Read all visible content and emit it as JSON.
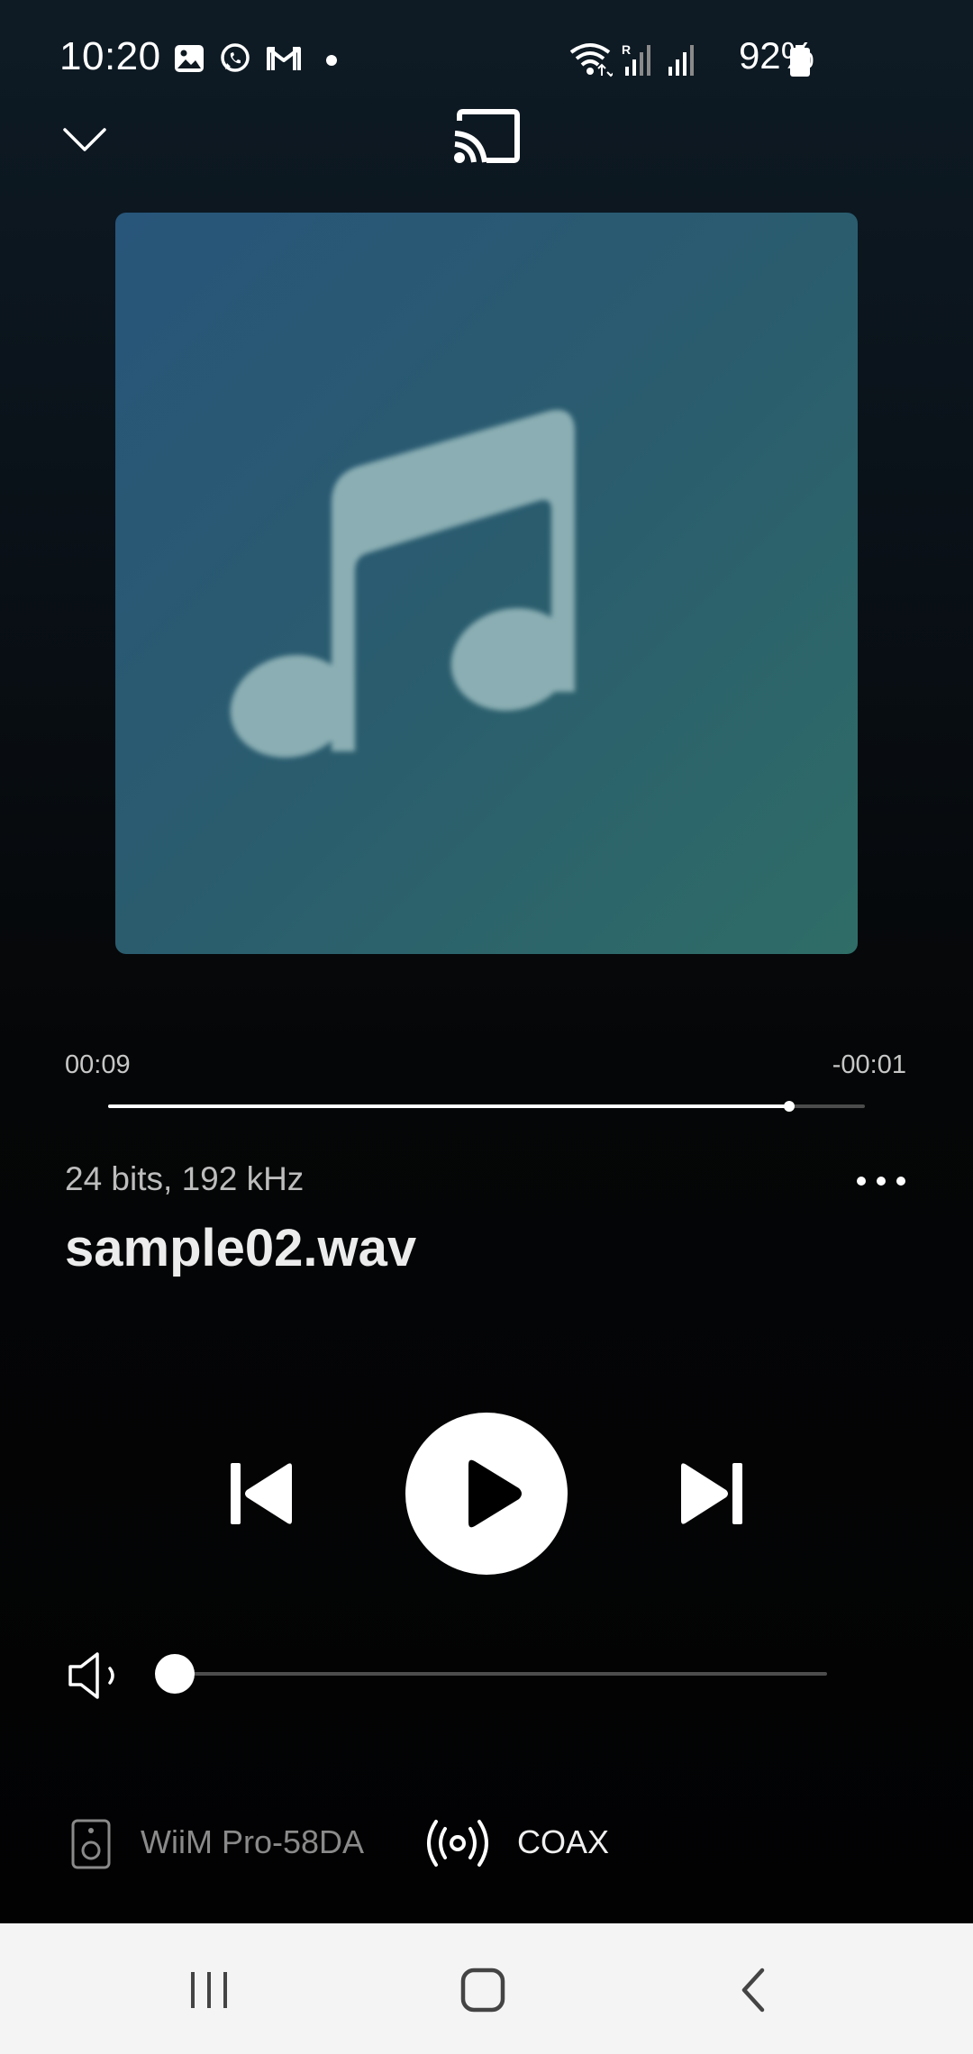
{
  "status_bar": {
    "time": "10:20",
    "battery": "92%",
    "icons": [
      "gallery-icon",
      "whatsapp-icon",
      "gmail-icon",
      "dot-icon",
      "wifi-icon",
      "signal-roaming-icon",
      "signal-icon",
      "battery-icon"
    ]
  },
  "player": {
    "artwork_icon": "music-note-icon",
    "elapsed": "00:09",
    "remaining": "-00:01",
    "progress_fraction": 0.9,
    "audio_format": "24 bits, 192 kHz",
    "title": "sample02.wav",
    "volume_fraction": 0.0
  },
  "output": {
    "device_name": "WiiM Pro-58DA",
    "input_name": "COAX"
  },
  "colors": {
    "accent": "#ffffff",
    "artwork_start": "#28557a",
    "artwork_end": "#2f6d67"
  }
}
